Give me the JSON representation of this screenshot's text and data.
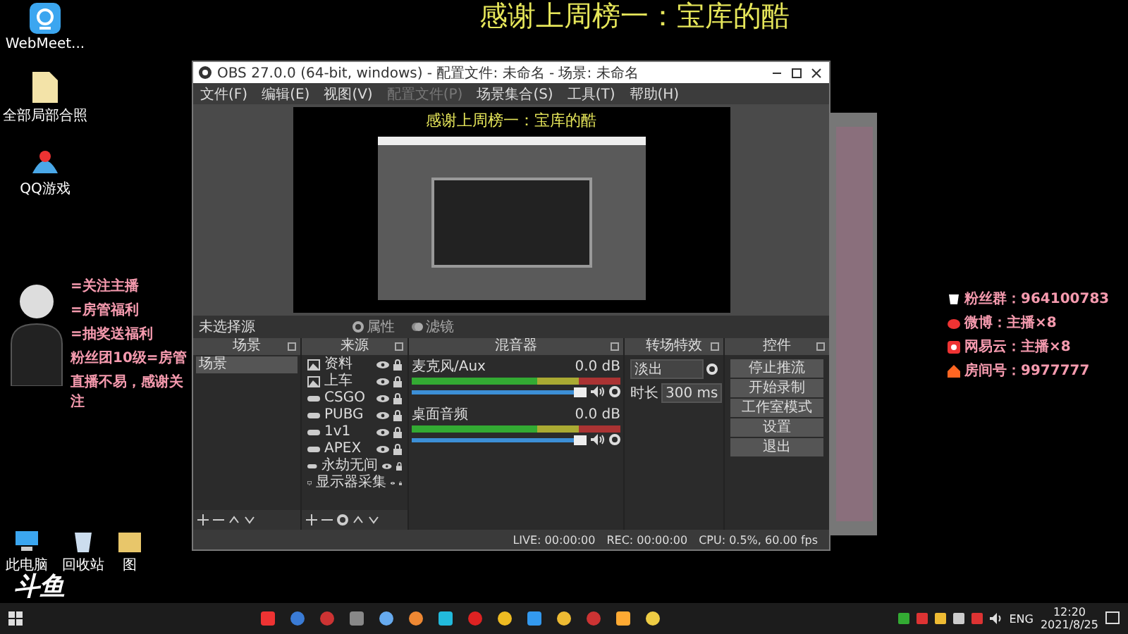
{
  "banner": {
    "text": "感谢上周榜一：宝库的酷"
  },
  "desktop_icons": [
    {
      "label": "WebMeet..."
    },
    {
      "label": "全部局部合照"
    },
    {
      "label": "QQ游戏"
    }
  ],
  "overlay_left": {
    "lines": [
      "=关注主播",
      "=房管福利",
      "=抽奖送福利",
      "粉丝团10级=房管",
      "直播不易，感谢关注"
    ]
  },
  "overlay_right": {
    "lines": [
      "粉丝群：964100783",
      "微博：主播×8",
      "网易云：主播×8",
      "房间号：9977777"
    ]
  },
  "obs": {
    "title": "OBS 27.0.0 (64-bit, windows) - 配置文件: 未命名 - 场景: 未命名",
    "menu": [
      {
        "label": "文件(F)",
        "disabled": false
      },
      {
        "label": "编辑(E)",
        "disabled": false
      },
      {
        "label": "视图(V)",
        "disabled": false
      },
      {
        "label": "配置文件(P)",
        "disabled": true
      },
      {
        "label": "场景集合(S)",
        "disabled": false
      },
      {
        "label": "工具(T)",
        "disabled": false
      },
      {
        "label": "帮助(H)",
        "disabled": false
      }
    ],
    "preview": {
      "banner": "感谢上周榜一：宝库的酷"
    },
    "source_bar": {
      "label": "未选择源",
      "properties": "属性",
      "filters": "滤镜"
    },
    "scenes": {
      "title": "场景",
      "items": [
        {
          "label": "场景",
          "selected": true
        }
      ]
    },
    "sources": {
      "title": "来源",
      "items": [
        {
          "label": "资料",
          "kind": "image"
        },
        {
          "label": "上车",
          "kind": "image"
        },
        {
          "label": "CSGO",
          "kind": "game"
        },
        {
          "label": "PUBG",
          "kind": "game"
        },
        {
          "label": "1v1",
          "kind": "game"
        },
        {
          "label": "APEX",
          "kind": "game"
        },
        {
          "label": "永劫无间",
          "kind": "game"
        },
        {
          "label": "显示器采集",
          "kind": "display"
        }
      ]
    },
    "mixer": {
      "title": "混音器",
      "channels": [
        {
          "name": "麦克风/Aux",
          "reading": "0.0 dB",
          "level": 1.0
        },
        {
          "name": "桌面音频",
          "reading": "0.0 dB",
          "level": 1.0
        }
      ]
    },
    "transitions": {
      "title": "转场特效",
      "type": "淡出",
      "duration_label": "时长",
      "duration": "300 ms"
    },
    "controls": {
      "title": "控件",
      "buttons": [
        "停止推流",
        "开始录制",
        "工作室模式",
        "设置",
        "退出"
      ]
    },
    "status": {
      "live": "LIVE: 00:00:00",
      "rec": "REC: 00:00:00",
      "cpu": "CPU: 0.5%, 60.00 fps"
    }
  },
  "bottom_icons": [
    {
      "label": "此电脑"
    },
    {
      "label": "回收站"
    },
    {
      "label": "图"
    }
  ],
  "logo": {
    "text": "斗鱼"
  },
  "taskbar": {
    "language": "ENG",
    "time": "12:20",
    "date": "2021/8/25"
  }
}
